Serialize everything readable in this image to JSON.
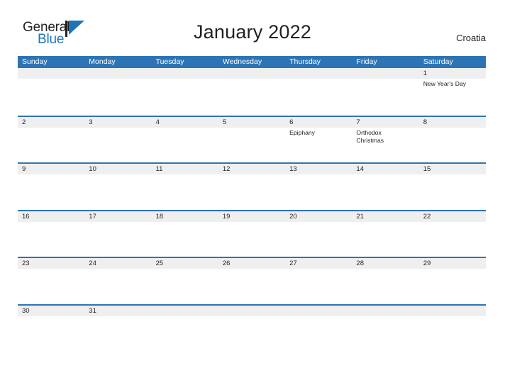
{
  "brand": {
    "word_one": "General",
    "word_two": "Blue",
    "mark_name": "sail-triangle-logo-mark",
    "color_blue": "#1b75bb",
    "color_dark": "#231f20"
  },
  "header": {
    "title": "January 2022",
    "country": "Croatia"
  },
  "theme": {
    "header_blue": "#2d74b5",
    "date_band_gray": "#efefef",
    "text": "#231f20"
  },
  "calendar": {
    "weekdays": [
      "Sunday",
      "Monday",
      "Tuesday",
      "Wednesday",
      "Thursday",
      "Friday",
      "Saturday"
    ],
    "weeks": [
      {
        "days": [
          {
            "date": "",
            "events": []
          },
          {
            "date": "",
            "events": []
          },
          {
            "date": "",
            "events": []
          },
          {
            "date": "",
            "events": []
          },
          {
            "date": "",
            "events": []
          },
          {
            "date": "",
            "events": []
          },
          {
            "date": "1",
            "events": [
              "New Year's Day"
            ]
          }
        ]
      },
      {
        "days": [
          {
            "date": "2",
            "events": []
          },
          {
            "date": "3",
            "events": []
          },
          {
            "date": "4",
            "events": []
          },
          {
            "date": "5",
            "events": []
          },
          {
            "date": "6",
            "events": [
              "Epiphany"
            ]
          },
          {
            "date": "7",
            "events": [
              "Orthodox",
              "Christmas"
            ]
          },
          {
            "date": "8",
            "events": []
          }
        ]
      },
      {
        "days": [
          {
            "date": "9",
            "events": []
          },
          {
            "date": "10",
            "events": []
          },
          {
            "date": "11",
            "events": []
          },
          {
            "date": "12",
            "events": []
          },
          {
            "date": "13",
            "events": []
          },
          {
            "date": "14",
            "events": []
          },
          {
            "date": "15",
            "events": []
          }
        ]
      },
      {
        "days": [
          {
            "date": "16",
            "events": []
          },
          {
            "date": "17",
            "events": []
          },
          {
            "date": "18",
            "events": []
          },
          {
            "date": "19",
            "events": []
          },
          {
            "date": "20",
            "events": []
          },
          {
            "date": "21",
            "events": []
          },
          {
            "date": "22",
            "events": []
          }
        ]
      },
      {
        "days": [
          {
            "date": "23",
            "events": []
          },
          {
            "date": "24",
            "events": []
          },
          {
            "date": "25",
            "events": []
          },
          {
            "date": "26",
            "events": []
          },
          {
            "date": "27",
            "events": []
          },
          {
            "date": "28",
            "events": []
          },
          {
            "date": "29",
            "events": []
          }
        ]
      },
      {
        "days": [
          {
            "date": "30",
            "events": []
          },
          {
            "date": "31",
            "events": []
          },
          {
            "date": "",
            "events": []
          },
          {
            "date": "",
            "events": []
          },
          {
            "date": "",
            "events": []
          },
          {
            "date": "",
            "events": []
          },
          {
            "date": "",
            "events": []
          }
        ]
      }
    ]
  }
}
